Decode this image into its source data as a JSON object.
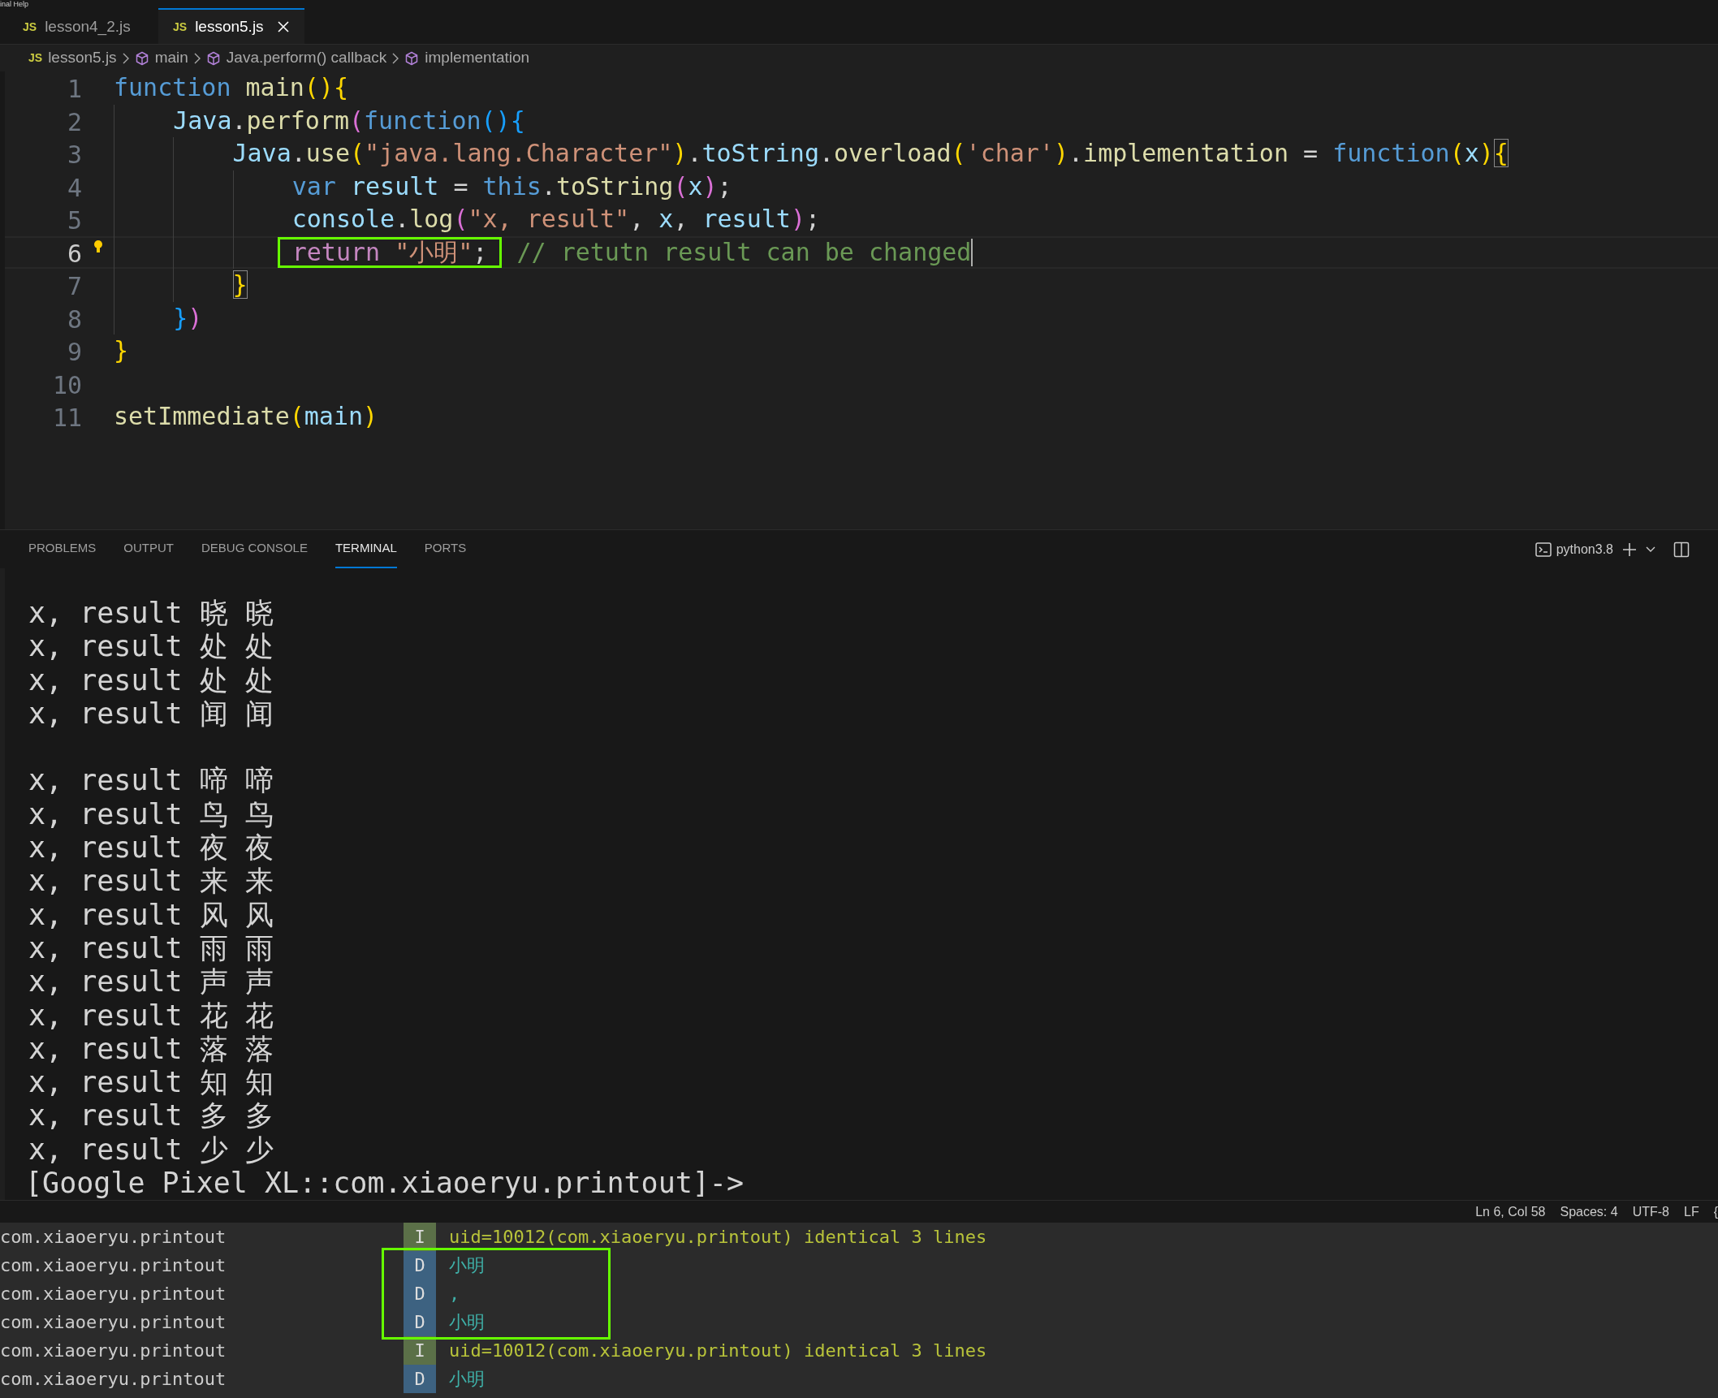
{
  "menu_bar": {
    "text": "inal Help"
  },
  "tabs": [
    {
      "label": "lesson4_2.js",
      "badge": "JS",
      "selected": false
    },
    {
      "label": "lesson5.js",
      "badge": "JS",
      "selected": true
    }
  ],
  "breadcrumbs": [
    {
      "kind": "file",
      "badge": "JS",
      "label": "lesson5.js"
    },
    {
      "kind": "symbol",
      "label": "main"
    },
    {
      "kind": "symbol",
      "label": "Java.perform() callback"
    },
    {
      "kind": "symbol",
      "label": "implementation"
    }
  ],
  "editor": {
    "lines": [
      {
        "number": "1",
        "current": false,
        "tokens": [
          {
            "kind": "keyword",
            "text": "function"
          },
          {
            "kind": "func",
            "text": " main"
          },
          {
            "kind": "b1",
            "text": "(){"
          }
        ]
      },
      {
        "number": "2",
        "current": false,
        "tokens": [
          {
            "kind": "var",
            "text": "    Java"
          },
          {
            "kind": "plain",
            "text": "."
          },
          {
            "kind": "func",
            "text": "perform"
          },
          {
            "kind": "b2",
            "text": "("
          },
          {
            "kind": "keyword",
            "text": "function"
          },
          {
            "kind": "b3",
            "text": "(){"
          }
        ]
      },
      {
        "number": "3",
        "current": false,
        "tokens": [
          {
            "kind": "var",
            "text": "        Java"
          },
          {
            "kind": "plain",
            "text": "."
          },
          {
            "kind": "func",
            "text": "use"
          },
          {
            "kind": "b1",
            "text": "("
          },
          {
            "kind": "string",
            "text": "\"java.lang.Character\""
          },
          {
            "kind": "b1",
            "text": ")"
          },
          {
            "kind": "plain",
            "text": "."
          },
          {
            "kind": "var",
            "text": "toString"
          },
          {
            "kind": "plain",
            "text": "."
          },
          {
            "kind": "func",
            "text": "overload"
          },
          {
            "kind": "b1",
            "text": "("
          },
          {
            "kind": "string",
            "text": "'char'"
          },
          {
            "kind": "b1",
            "text": ")"
          },
          {
            "kind": "plain",
            "text": "."
          },
          {
            "kind": "func",
            "text": "implementation"
          },
          {
            "kind": "plain",
            "text": " = "
          },
          {
            "kind": "keyword",
            "text": "function"
          },
          {
            "kind": "b1",
            "text": "("
          },
          {
            "kind": "var",
            "text": "x"
          },
          {
            "kind": "b1",
            "text": ")"
          },
          {
            "kind": "b1",
            "text": "{",
            "matched": true
          }
        ]
      },
      {
        "number": "4",
        "current": false,
        "tokens": [
          {
            "kind": "keyword",
            "text": "            var"
          },
          {
            "kind": "var",
            "text": " result"
          },
          {
            "kind": "plain",
            "text": " = "
          },
          {
            "kind": "keyword",
            "text": "this"
          },
          {
            "kind": "plain",
            "text": "."
          },
          {
            "kind": "func",
            "text": "toString"
          },
          {
            "kind": "b2",
            "text": "("
          },
          {
            "kind": "var",
            "text": "x"
          },
          {
            "kind": "b2",
            "text": ")"
          },
          {
            "kind": "plain",
            "text": ";"
          }
        ]
      },
      {
        "number": "5",
        "current": false,
        "tokens": [
          {
            "kind": "var",
            "text": "            console"
          },
          {
            "kind": "plain",
            "text": "."
          },
          {
            "kind": "func",
            "text": "log"
          },
          {
            "kind": "b2",
            "text": "("
          },
          {
            "kind": "string",
            "text": "\"x, result\""
          },
          {
            "kind": "plain",
            "text": ", "
          },
          {
            "kind": "var",
            "text": "x"
          },
          {
            "kind": "plain",
            "text": ", "
          },
          {
            "kind": "var",
            "text": "result"
          },
          {
            "kind": "b2",
            "text": ")"
          },
          {
            "kind": "plain",
            "text": ";"
          }
        ]
      },
      {
        "number": "6",
        "current": true,
        "lightbulb": true,
        "cursor": true,
        "tokens": [
          {
            "kind": "control",
            "text": "            return",
            "boxed": true
          },
          {
            "kind": "string",
            "text": " \"小明\"",
            "boxed": true
          },
          {
            "kind": "plain",
            "text": ";",
            "boxed": true
          },
          {
            "kind": "comment",
            "text": "  // retutn result can be changed"
          }
        ]
      },
      {
        "number": "7",
        "current": false,
        "tokens": [
          {
            "kind": "b1",
            "text": "        }",
            "matched": true
          }
        ]
      },
      {
        "number": "8",
        "current": false,
        "tokens": [
          {
            "kind": "b3",
            "text": "    }"
          },
          {
            "kind": "b2",
            "text": ")"
          }
        ]
      },
      {
        "number": "9",
        "current": false,
        "tokens": [
          {
            "kind": "b1",
            "text": "}"
          }
        ]
      },
      {
        "number": "10",
        "current": false
      },
      {
        "number": "11",
        "current": false,
        "tokens": [
          {
            "kind": "func",
            "text": "setImmediate"
          },
          {
            "kind": "b1",
            "text": "("
          },
          {
            "kind": "var",
            "text": "main"
          },
          {
            "kind": "b1",
            "text": ")"
          }
        ]
      }
    ]
  },
  "panel": {
    "tabs": [
      {
        "label": "PROBLEMS",
        "selected": false
      },
      {
        "label": "OUTPUT",
        "selected": false
      },
      {
        "label": "DEBUG CONSOLE",
        "selected": false
      },
      {
        "label": "TERMINAL",
        "selected": true
      },
      {
        "label": "PORTS",
        "selected": false
      }
    ],
    "profile": "python3.8",
    "terminal_blocks": [
      [
        "x, result 晓 晓",
        "x, result 处 处",
        "x, result 处 处",
        "x, result 闻 闻"
      ],
      [
        "x, result 啼 啼",
        "x, result 鸟 鸟",
        "x, result 夜 夜",
        "x, result 来 来",
        "x, result 风 风",
        "x, result 雨 雨",
        "x, result 声 声",
        "x, result 花 花",
        "x, result 落 落",
        "x, result 知 知",
        "x, result 多 多",
        "x, result 少 少"
      ]
    ],
    "prompt": "[Google Pixel XL::com.xiaoeryu.printout]->"
  },
  "status_bar": {
    "items": [
      "Ln 6, Col 58",
      "Spaces: 4",
      "UTF-8",
      "LF",
      "{"
    ]
  },
  "logcat": {
    "rows": [
      {
        "package": "com.xiaoeryu.printout",
        "level": "I",
        "message": "uid=10012(com.xiaoeryu.printout) identical 3 lines",
        "boxed": false
      },
      {
        "package": "com.xiaoeryu.printout",
        "level": "D",
        "message": "小明",
        "boxed": true
      },
      {
        "package": "com.xiaoeryu.printout",
        "level": "D",
        "message": ",",
        "boxed": true
      },
      {
        "package": "com.xiaoeryu.printout",
        "level": "D",
        "message": "小明",
        "boxed": true
      },
      {
        "package": "com.xiaoeryu.printout",
        "level": "I",
        "message": "uid=10012(com.xiaoeryu.printout) identical 3 lines",
        "boxed": false
      },
      {
        "package": "com.xiaoeryu.printout",
        "level": "D",
        "message": "小明",
        "boxed": false
      }
    ]
  }
}
